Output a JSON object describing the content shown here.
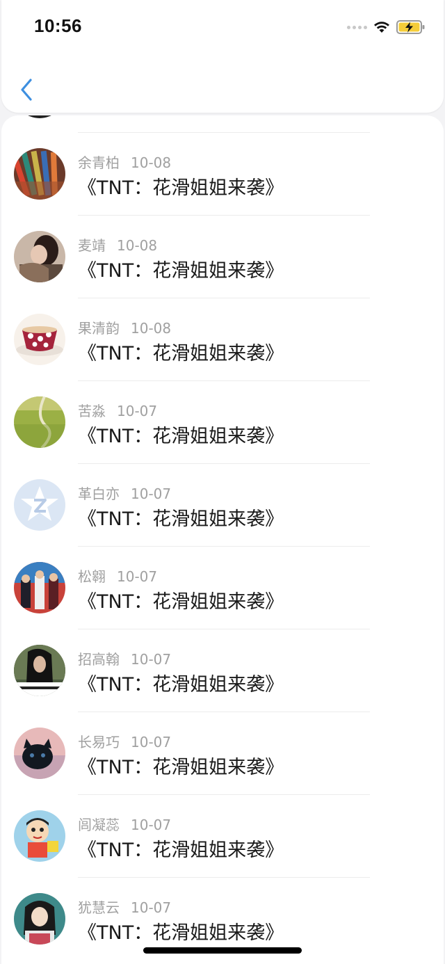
{
  "status_bar": {
    "time": "10:56",
    "icons": [
      "signal-dots-icon",
      "wifi-icon",
      "battery-charging-icon"
    ]
  },
  "nav": {
    "back_icon": "chevron-left-icon",
    "accent_color": "#3d8fe0"
  },
  "comments": [
    {
      "name": "余青柏",
      "date": "10-08",
      "text": "《TNT：花滑姐姐来袭》",
      "avatar": "colored-pencils"
    },
    {
      "name": "麦靖",
      "date": "10-08",
      "text": "《TNT：花滑姐姐来袭》",
      "avatar": "girl-portrait"
    },
    {
      "name": "果清韵",
      "date": "10-08",
      "text": "《TNT：花滑姐姐来袭》",
      "avatar": "polka-dot-cup"
    },
    {
      "name": "苦淼",
      "date": "10-07",
      "text": "《TNT：花滑姐姐来袭》",
      "avatar": "green-field"
    },
    {
      "name": "革白亦",
      "date": "10-07",
      "text": "《TNT：花滑姐姐来袭》",
      "avatar": "default-qzone-star"
    },
    {
      "name": "松翱",
      "date": "10-07",
      "text": "《TNT：花滑姐姐来袭》",
      "avatar": "group-of-three"
    },
    {
      "name": "招高翰",
      "date": "10-07",
      "text": "《TNT：花滑姐姐来袭》",
      "avatar": "girl-with-text"
    },
    {
      "name": "长易巧",
      "date": "10-07",
      "text": "《TNT：花滑姐姐来袭》",
      "avatar": "black-kitten"
    },
    {
      "name": "闾凝蕊",
      "date": "10-07",
      "text": "《TNT：花滑姐姐来袭》",
      "avatar": "cartoon-kid"
    },
    {
      "name": "犹慧云",
      "date": "10-07",
      "text": "《TNT：花滑姐姐来袭》",
      "avatar": "anime-girl"
    }
  ]
}
